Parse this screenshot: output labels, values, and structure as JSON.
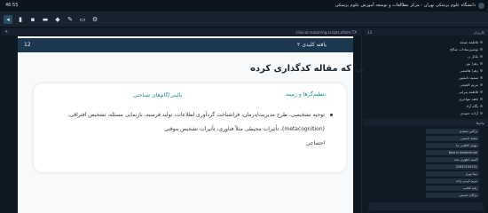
{
  "titlebar": {
    "time": "46:55",
    "title": "دانشگاه علوم پزشکی تهران - مرکز مطالعات و توسعه آموزش علوم پزشکی"
  },
  "toolbar": {
    "icons": [
      "mic-icon",
      "camera-icon",
      "share-icon",
      "chat-icon",
      "pen-icon",
      "screen-icon",
      "settings-icon"
    ]
  },
  "main_header": {
    "url": "clinical.reasoning.scripts.ofnlrn.TX"
  },
  "slide": {
    "page": "12",
    "nav_text": "یافته کلیدی ۲",
    "title": "دامنه‌های استدلال بالینی که مقاله کدگذاری کرده",
    "col_left_head": "تنظیم‌گرها و زمینه",
    "col_right_head": "بالینی/گام‌های شناختی",
    "line1": "توجیه تشخیصی، طرح مدیریت/درمان، فراشناخت   گردآوری اطلاعات، تولید فرضیه، بازنمایی مسئله، تشخیص افتراقی،",
    "line2": "(metacognition)، تأثیرات محیطی مثلاً فناوری، تأثیرات   تشخیص موقتی",
    "line3": "اجتماعی"
  },
  "right_panel": {
    "users_label": "کاربران",
    "users_count": "13",
    "users": [
      "فاطمه ضیغه",
      "نوشین‌سادات صالح",
      "مائل ن",
      "زهرا نور",
      "زهرا هاشمی",
      "سمیه دانشور",
      "مریم لاهیجی",
      "فاطمه پیرانی",
      "ناهید مهاجری",
      "پگاه آزاد",
      "آزاده حمیدی"
    ],
    "chat_label": "پیام‌ها",
    "messages": [
      "نرگس سعیدی",
      "سعید حسینی",
      "مهدی کاظمی نیا",
      "Nasrin Nadimkhah",
      "آنیسه اطهری مجد",
      "32830190231",
      "مینا نوری",
      "مریم کرمی زاده",
      "زهرا غلامی",
      "مژگان حسینی"
    ]
  },
  "colors": {
    "accent": "#178a8f",
    "nav": "#1c3750",
    "bg": "#0f1a25"
  }
}
